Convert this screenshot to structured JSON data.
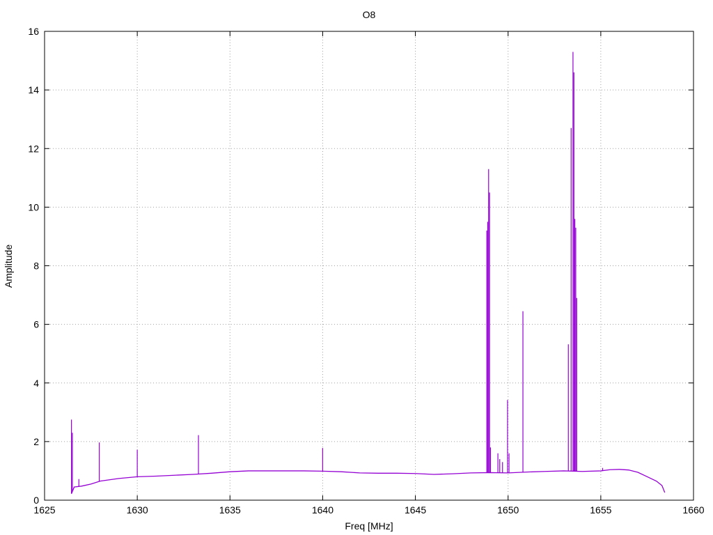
{
  "chart_data": {
    "type": "line",
    "title": "O8",
    "xlabel": "Freq [MHz]",
    "ylabel": "Amplitude",
    "xlim": [
      1625,
      1660
    ],
    "ylim": [
      0,
      16
    ],
    "xticks": [
      1625,
      1630,
      1635,
      1640,
      1645,
      1650,
      1655,
      1660
    ],
    "yticks": [
      0,
      2,
      4,
      6,
      8,
      10,
      12,
      14,
      16
    ],
    "grid": true,
    "line_color": "#9400D3",
    "baseline": {
      "x": [
        1626.45,
        1626.6,
        1627.0,
        1627.5,
        1628.0,
        1629.0,
        1630.0,
        1631.0,
        1632.0,
        1633.0,
        1634.0,
        1635.0,
        1636.0,
        1637.0,
        1638.0,
        1639.0,
        1640.0,
        1641.0,
        1642.0,
        1643.0,
        1644.0,
        1645.0,
        1646.0,
        1647.0,
        1648.0,
        1649.0,
        1650.0,
        1651.0,
        1652.0,
        1653.0,
        1654.0,
        1655.0,
        1655.5,
        1656.0,
        1656.5,
        1657.0,
        1657.5,
        1658.0,
        1658.3,
        1658.45
      ],
      "y": [
        0.22,
        0.45,
        0.48,
        0.55,
        0.65,
        0.74,
        0.8,
        0.82,
        0.85,
        0.88,
        0.92,
        0.97,
        1.0,
        1.0,
        1.0,
        1.0,
        0.99,
        0.97,
        0.93,
        0.92,
        0.92,
        0.91,
        0.88,
        0.9,
        0.93,
        0.94,
        0.93,
        0.96,
        0.98,
        1.0,
        0.98,
        1.0,
        1.04,
        1.05,
        1.03,
        0.95,
        0.8,
        0.65,
        0.5,
        0.26
      ]
    },
    "spikes": [
      {
        "x": 1626.45,
        "y": 2.75
      },
      {
        "x": 1626.5,
        "y": 2.3
      },
      {
        "x": 1626.85,
        "y": 0.72
      },
      {
        "x": 1627.95,
        "y": 1.97
      },
      {
        "x": 1630.0,
        "y": 1.72
      },
      {
        "x": 1633.3,
        "y": 2.22
      },
      {
        "x": 1640.0,
        "y": 1.78
      },
      {
        "x": 1648.85,
        "y": 9.2
      },
      {
        "x": 1648.9,
        "y": 9.5
      },
      {
        "x": 1648.95,
        "y": 11.3
      },
      {
        "x": 1649.0,
        "y": 10.5
      },
      {
        "x": 1649.05,
        "y": 1.8
      },
      {
        "x": 1649.45,
        "y": 1.6
      },
      {
        "x": 1649.55,
        "y": 1.4
      },
      {
        "x": 1649.7,
        "y": 1.3
      },
      {
        "x": 1649.97,
        "y": 3.42
      },
      {
        "x": 1650.05,
        "y": 1.6
      },
      {
        "x": 1650.8,
        "y": 6.45
      },
      {
        "x": 1653.25,
        "y": 5.32
      },
      {
        "x": 1653.4,
        "y": 12.7
      },
      {
        "x": 1653.5,
        "y": 15.3
      },
      {
        "x": 1653.55,
        "y": 14.6
      },
      {
        "x": 1653.6,
        "y": 9.6
      },
      {
        "x": 1653.65,
        "y": 9.3
      },
      {
        "x": 1653.7,
        "y": 6.9
      },
      {
        "x": 1655.1,
        "y": 1.1
      }
    ]
  }
}
